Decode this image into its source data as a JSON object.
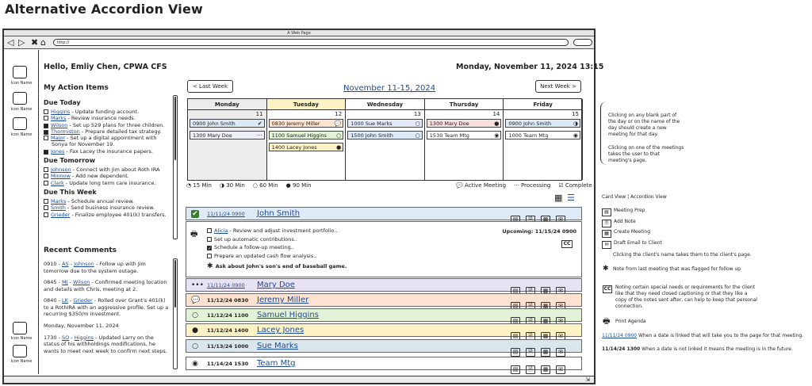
{
  "page_title": "Alternative Accordion View",
  "browser": {
    "title": "A Web Page",
    "url": "http://",
    "nav": [
      "◁",
      "▷",
      "✖",
      "⌂"
    ]
  },
  "sidebar": {
    "icon_label": "Icon Name"
  },
  "status_icon": "⇲",
  "header": {
    "greeting": "Hello, Emliy Chen, CPWA CFS",
    "datetime": "Monday, November 11, 2024 13:15"
  },
  "action_items": {
    "title": "My Action Items",
    "groups": [
      {
        "title": "Due Today",
        "items": [
          {
            "checked": false,
            "name": "Higgins",
            "text": " - Update funding account."
          },
          {
            "checked": false,
            "name": "Marks",
            "text": " - Review insurance needs."
          },
          {
            "checked": true,
            "name": "Wilson",
            "text": " - Set up 529 plans for three children."
          },
          {
            "checked": true,
            "name": "Thormiston",
            "text": " - Prepare detailed tax strategy."
          },
          {
            "checked": false,
            "name": "Major",
            "text": " - Set up a digital appointment with Sonya for November 19."
          },
          {
            "checked": true,
            "name": "Jones",
            "text": " - Fax Lacey the insurance papers."
          }
        ]
      },
      {
        "title": "Due Tomorrow",
        "items": [
          {
            "checked": false,
            "name": "Johnson",
            "text": " - Connect with Jim about Roth IRA"
          },
          {
            "checked": false,
            "name": "Minnow",
            "text": " - Add new dependent."
          },
          {
            "checked": false,
            "name": "Clark",
            "text": " - Update long term care insurance."
          }
        ]
      },
      {
        "title": "Due This Week",
        "items": [
          {
            "checked": false,
            "name": "Marks",
            "text": " - Schedule annual review."
          },
          {
            "checked": false,
            "name": "Smith",
            "text": " - Send business insurance review."
          },
          {
            "checked": false,
            "name": "Grieder",
            "text": " - Finalize employee 401(k) transfers."
          }
        ]
      }
    ]
  },
  "comments": {
    "title": "Recent Comments",
    "date_header": "Monday, November 11, 2024",
    "items": [
      {
        "time": "0910",
        "user": "AS",
        "client": "Johnson",
        "text": " - Follow up with Jim tomorrow due to the system outage."
      },
      {
        "time": "0845",
        "user": "MJ",
        "client": "Wilson",
        "text": " - Confirmed meeting location and details with Chris, meeting at 2."
      },
      {
        "time": "0840",
        "user": "LK",
        "client": "Grieder",
        "text": " - Rolled over Grant's 401(k) to a RothIRA with an aggressive profile. Set up a recurring $350/m investment."
      },
      {
        "time": "1730",
        "user": "SO",
        "client": "Higgins",
        "text": " - Updated Larry on the status of his withholdings modifications, he wants to meet next week to confirm next steps."
      }
    ]
  },
  "calendar": {
    "prev": "< Last Week",
    "next": "Next Week >",
    "range": "November 11-15, 2024",
    "days": [
      {
        "name": "Monday",
        "num": "11",
        "meetings": [
          {
            "label": "0900 John Smith",
            "status": "✔",
            "color": "#dce9f7"
          },
          {
            "label": "1300 Mary Doe",
            "status": "···",
            "color": "#eef0f7"
          }
        ]
      },
      {
        "name": "Tuesday",
        "num": "12",
        "meetings": [
          {
            "label": "0830 Jeremy Miller",
            "status": "💬",
            "color": "#fde3cf"
          },
          {
            "label": "1100 Samuel Higgins",
            "status": "○",
            "color": "#e2f2d7"
          },
          {
            "label": "1400 Lacey Jones",
            "status": "●",
            "color": "#fdf2c4"
          }
        ]
      },
      {
        "name": "Wednesday",
        "num": "13",
        "meetings": [
          {
            "label": "1000 Sue Marks",
            "status": "○",
            "color": "#e3e9f8"
          },
          {
            "label": "1500 John Smith",
            "status": "○",
            "color": "#dce9f7"
          }
        ]
      },
      {
        "name": "Thursday",
        "num": "14",
        "meetings": [
          {
            "label": "1300 Mary Doe",
            "status": "●",
            "color": "#f7dede"
          },
          {
            "label": "1530 Team Mtg",
            "status": "◉",
            "color": "#ffffff"
          }
        ]
      },
      {
        "name": "Friday",
        "num": "15",
        "meetings": [
          {
            "label": "0900 John Smith",
            "status": "◑",
            "color": "#dce9f7"
          },
          {
            "label": "1000 Team Mtg",
            "status": "◉",
            "color": "#ffffff"
          }
        ]
      }
    ],
    "legend": [
      "◔ 15 Min",
      "◑ 30 Min",
      "○ 60 Min",
      "● 90 Min"
    ],
    "legend_right": [
      "💬 Active Meeting",
      "··· Processing",
      "☑ Complete"
    ]
  },
  "agenda": {
    "rows": [
      {
        "status": "✔",
        "date": "11/11/24 0900",
        "name": "John Smith",
        "linked": true,
        "color": "#dfeaf7"
      },
      {
        "status": "•••",
        "date": "11/11/24 0900",
        "name": "Mary Doe",
        "linked": true,
        "color": "#e8e3f3"
      },
      {
        "status": "💬",
        "date": "11/12/24 0830",
        "name": "Jeremy Miller",
        "linked": false,
        "color": "#fde3cf"
      },
      {
        "status": "○",
        "date": "11/12/24 1100",
        "name": "Samuel Higgins",
        "linked": false,
        "color": "#e2f2d7"
      },
      {
        "status": "●",
        "date": "11/12/24 1400",
        "name": "Lacey Jones",
        "linked": false,
        "color": "#fdf2c4"
      },
      {
        "status": "○",
        "date": "11/13/24 1000",
        "name": "Sue Marks",
        "linked": false,
        "color": "#d9e6ec"
      },
      {
        "status": "◉",
        "date": "11/14/24 1530",
        "name": "Team Mtg",
        "linked": false,
        "color": "#ffffff"
      }
    ],
    "expanded": {
      "tasks": [
        {
          "checked": false,
          "name": "Alicia",
          "text": " - Review and adjust investment portfolio.."
        },
        {
          "checked": false,
          "name": "",
          "text": "Set up automatic contributions.."
        },
        {
          "checked": true,
          "name": "",
          "text": "Schedule a follow-up meeting.."
        },
        {
          "checked": false,
          "name": "",
          "text": "Prepare an updated cash flow analysis.."
        }
      ],
      "note": "Ask about John's son's end of baseball game.",
      "upcoming": "Upcoming: 11/15/24 0900",
      "cc": "CC"
    }
  },
  "annotations": {
    "top": "Clicking on any blank part of the day or on the name of the day should create a new meeting for that day.",
    "top2": "Clicking on one of the meetings takes the user to that meeting's page.",
    "view_title": "Card View | Accordion View",
    "actions": [
      "Meeting Prep",
      "Add Note",
      "Create Meeting",
      "Draft Email to Client"
    ],
    "client_click": "Clicking the client's name takes them to the client's page.",
    "flag_note": "Note from last meeting that was flagged for follow up",
    "cc_note": "Noting certain special needs or requirements for the client like that they need closed captioning or that they like a copy of the notes sent after, can help to keep that personal connection.",
    "print": "Print Agenda",
    "linked_date": "11/11/24 0900",
    "linked_text": "When a date is linked that will take you to the page for that meeting.",
    "unlinked_date": "11/14/24 1300",
    "unlinked_text": "When a date is not linked it means the meeting is in the future."
  }
}
